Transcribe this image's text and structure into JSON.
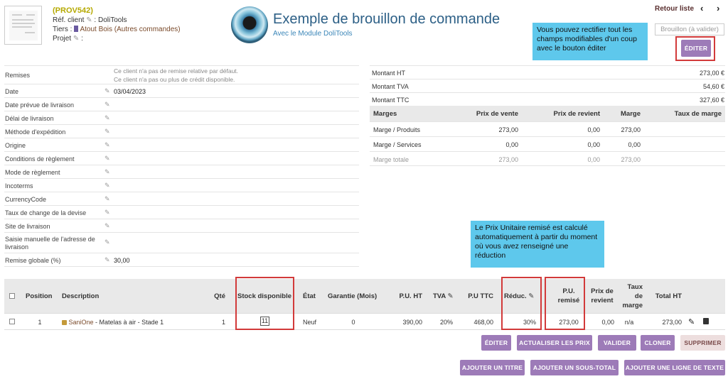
{
  "header": {
    "ref": "(PROV542)",
    "ref_client_label": "Réf. client",
    "ref_client_value": ": DoliTools",
    "tiers_label": "Tiers :",
    "tiers_value": "Atout Bois (Autres commandes)",
    "projet_label": "Projet",
    "projet_value": ":",
    "logo_title": "Exemple de brouillon de commande",
    "logo_subtitle": "Avec le Module DoliTools",
    "retour_liste": "Retour liste",
    "prev_icon": "chevron-left-icon",
    "next_icon": "chevron-right-icon",
    "status": "Brouillon (à valider)"
  },
  "callouts": {
    "edit_tip": "Vous pouvez rectifier tout les champs modifiables d'un coup avec le bouton éditer",
    "pu_tip": "Le Prix Unitaire remisé est calculé automatiquement à partir du moment où vous avez renseigné une réduction"
  },
  "buttons": {
    "editer_top": "ÉDITER",
    "editer": "ÉDITER",
    "actualiser": "ACTUALISER LES PRIX",
    "valider": "VALIDER",
    "cloner": "CLONER",
    "supprimer": "SUPPRIMER",
    "ajouter_titre": "AJOUTER UN TITRE",
    "ajouter_sous_total": "AJOUTER UN SOUS-TOTAL",
    "ajouter_ligne_texte": "AJOUTER UNE LIGNE DE TEXTE"
  },
  "fields": {
    "remises_label": "Remises",
    "remises_note1": "Ce client n'a pas de remise relative par défaut.",
    "remises_note2": "Ce client n'a pas ou plus de crédit disponible.",
    "date_label": "Date",
    "date_value": "03/04/2023",
    "date_livraison": "Date prévue de livraison",
    "delai_livraison": "Délai de livraison",
    "methode_expedition": "Méthode d'expédition",
    "origine": "Origine",
    "conditions_reglement": "Conditions de règlement",
    "mode_reglement": "Mode de règlement",
    "incoterms": "Incoterms",
    "currency_code": "CurrencyCode",
    "taux_change": "Taux de change de la devise",
    "site_livraison": "Site de livraison",
    "saisie_adresse": "Saisie manuelle de l'adresse de livraison",
    "remise_globale_label": "Remise globale (%)",
    "remise_globale_value": "30,00"
  },
  "amounts": {
    "ht_label": "Montant HT",
    "ht_value": "273,00 €",
    "tva_label": "Montant TVA",
    "tva_value": "54,60 €",
    "ttc_label": "Montant TTC",
    "ttc_value": "327,60 €"
  },
  "margins": {
    "headers": [
      "Marges",
      "Prix de vente",
      "Prix de revient",
      "Marge",
      "Taux de marge"
    ],
    "rows": [
      {
        "label": "Marge / Produits",
        "vente": "273,00",
        "revient": "0,00",
        "marge": "273,00",
        "taux": ""
      },
      {
        "label": "Marge / Services",
        "vente": "0,00",
        "revient": "0,00",
        "marge": "0,00",
        "taux": ""
      },
      {
        "label": "Marge totale",
        "vente": "273,00",
        "revient": "0,00",
        "marge": "273,00",
        "taux": ""
      }
    ]
  },
  "lines": {
    "headers": {
      "position": "Position",
      "description": "Description",
      "qte": "Qté",
      "stock": "Stock disponible",
      "etat": "État",
      "garantie": "Garantie (Mois)",
      "pu_ht": "P.U. HT",
      "tva": "TVA",
      "pu_ttc": "P.U TTC",
      "reduc": "Réduc.",
      "pu_remise_1": "P.U.",
      "pu_remise_2": "remisé",
      "prix_revient_1": "Prix de",
      "prix_revient_2": "revient",
      "taux_marge_1": "Taux",
      "taux_marge_2": "de",
      "taux_marge_3": "marge",
      "total_ht": "Total HT"
    },
    "rows": [
      {
        "position": "1",
        "product_ref": "SaniOne",
        "product_desc": " - Matelas à air - Stade 1",
        "qte": "1",
        "stock": "11",
        "etat": "Neuf",
        "garantie": "0",
        "pu_ht": "390,00",
        "tva": "20%",
        "pu_ttc": "468,00",
        "reduc": "30%",
        "pu_remise": "273,00",
        "prix_revient": "0,00",
        "taux_marge": "n/a",
        "total_ht": "273,00"
      }
    ]
  },
  "colors": {
    "button": "#9d7bb8",
    "callout": "#5ec8ec",
    "highlight_box": "#d23a3a",
    "ref": "#b5a900"
  }
}
